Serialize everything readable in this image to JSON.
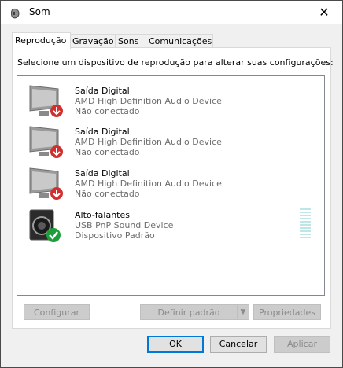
{
  "window": {
    "title": "Som",
    "close_label": "✕"
  },
  "tabs": [
    {
      "label": "Reprodução",
      "active": true
    },
    {
      "label": "Gravação",
      "active": false
    },
    {
      "label": "Sons",
      "active": false
    },
    {
      "label": "Comunicações",
      "active": false
    }
  ],
  "instruction": "Selecione um dispositivo de reprodução para alterar suas configurações:",
  "devices": [
    {
      "name": "Saída Digital",
      "description": "AMD High Definition Audio Device",
      "status": "Não conectado",
      "icon": "monitor-icon",
      "badge": "disconnected-arrow-icon"
    },
    {
      "name": "Saída Digital",
      "description": "AMD High Definition Audio Device",
      "status": "Não conectado",
      "icon": "monitor-icon",
      "badge": "disconnected-arrow-icon"
    },
    {
      "name": "Saída Digital",
      "description": "AMD High Definition Audio Device",
      "status": "Não conectado",
      "icon": "monitor-icon",
      "badge": "disconnected-arrow-icon"
    },
    {
      "name": "Alto-falantes",
      "description": "USB PnP Sound Device",
      "status": "Dispositivo Padrão",
      "icon": "speaker-icon",
      "badge": "default-check-icon"
    }
  ],
  "buttons": {
    "configure": "Configurar",
    "set_default": "Definir padrão",
    "properties": "Propriedades",
    "ok": "OK",
    "cancel": "Cancelar",
    "apply": "Aplicar"
  },
  "colors": {
    "accent": "#0078d7",
    "error_badge": "#d32f2f",
    "success_badge": "#1e9e3a",
    "meter": "#bfe6e6"
  }
}
